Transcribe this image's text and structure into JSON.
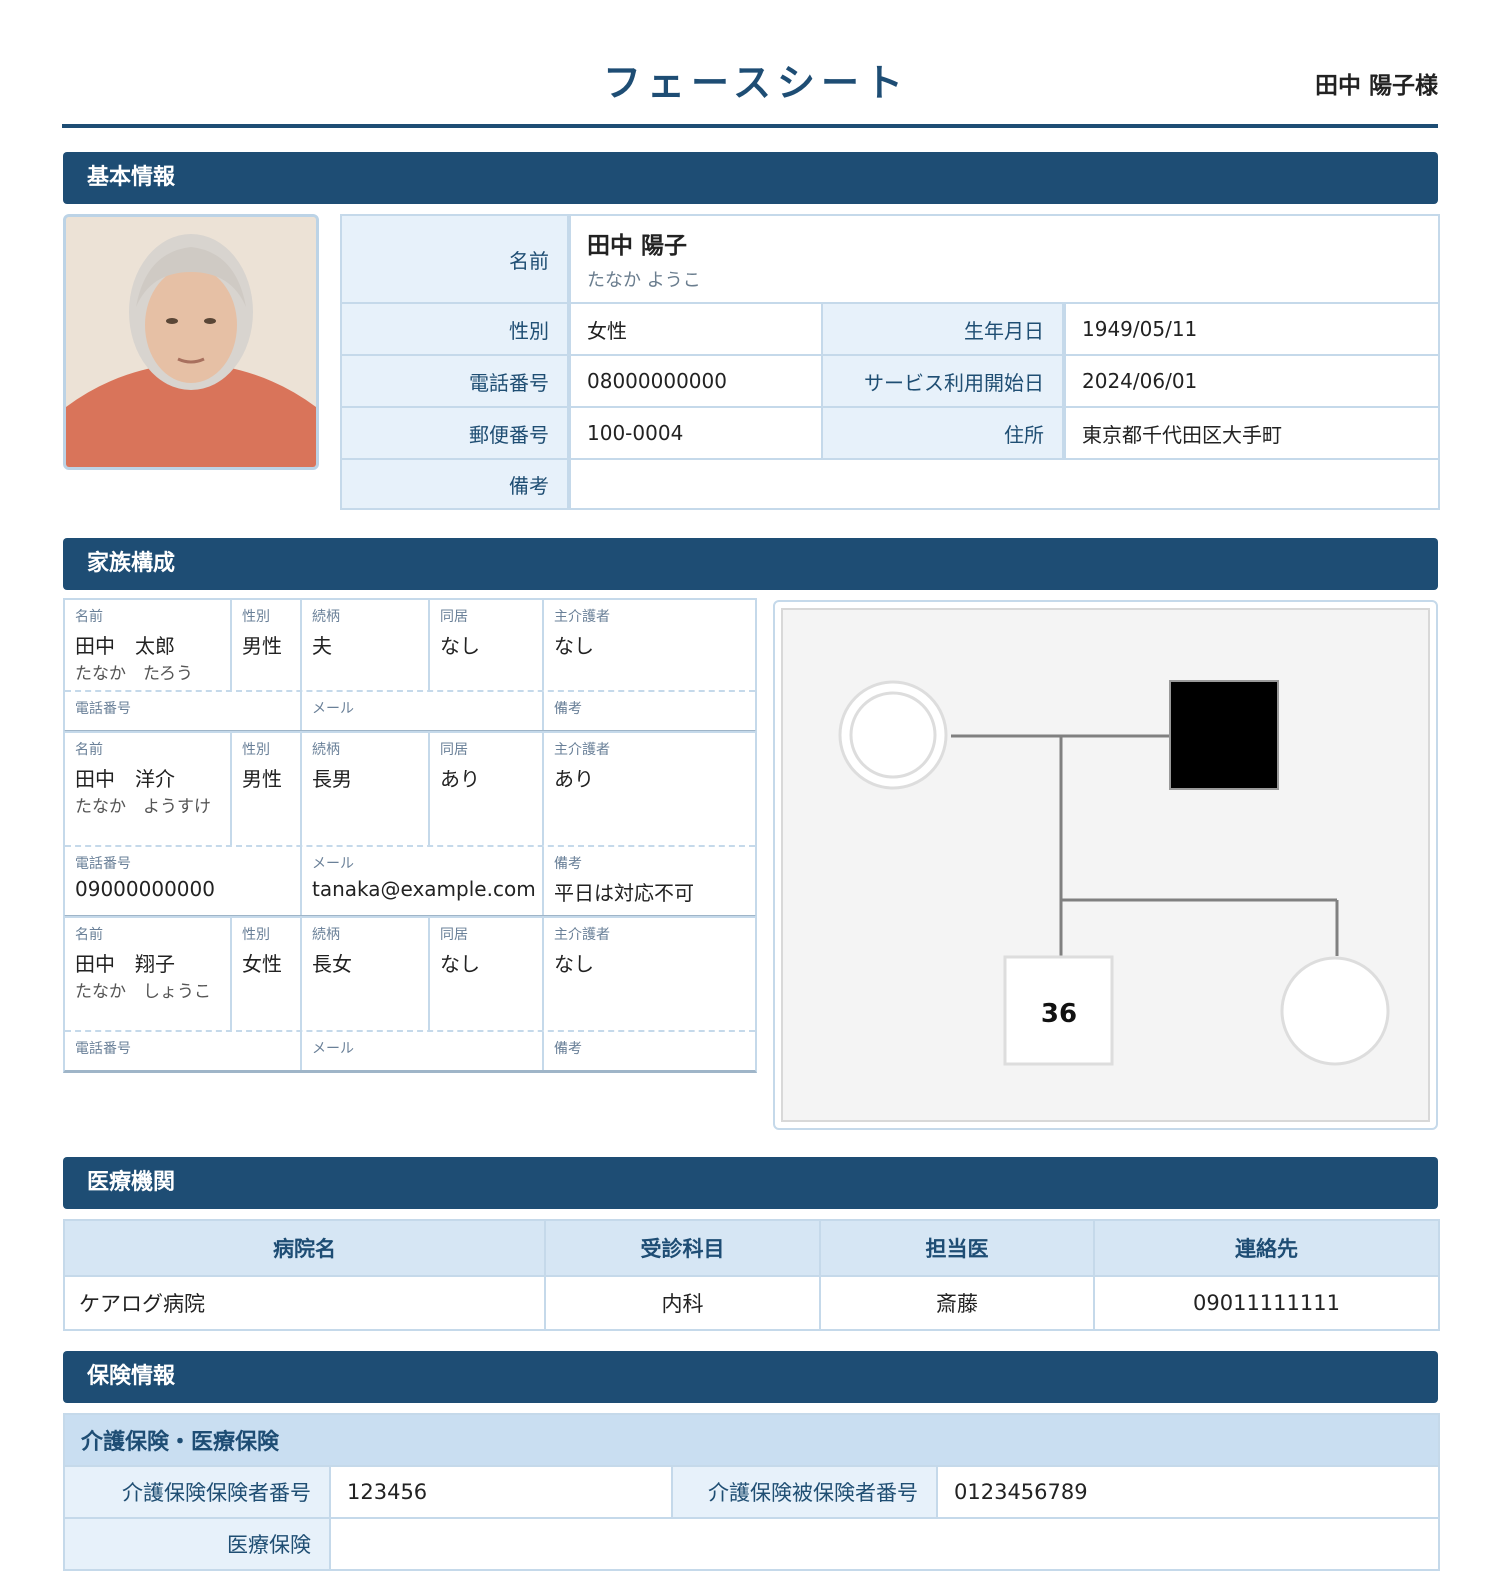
{
  "header": {
    "title": "フェースシート",
    "patient_name": "田中 陽子様"
  },
  "sections": {
    "basic": "基本情報",
    "family": "家族構成",
    "medical": "医療機関",
    "insurance": "保険情報"
  },
  "basic": {
    "labels": {
      "name": "名前",
      "gender": "性別",
      "birthdate": "生年月日",
      "phone": "電話番号",
      "service_start": "サービス利用開始日",
      "postal": "郵便番号",
      "address": "住所",
      "notes": "備考"
    },
    "name": "田中 陽子",
    "name_kana": "たなか ようこ",
    "gender": "女性",
    "birthdate": "1949/05/11",
    "phone": "08000000000",
    "service_start": "2024/06/01",
    "postal": "100-0004",
    "address": "東京都千代田区大手町",
    "notes": ""
  },
  "family": {
    "labels": {
      "name": "名前",
      "gender": "性別",
      "relation": "続柄",
      "cohabit": "同居",
      "caregiver": "主介護者",
      "phone": "電話番号",
      "email": "メール",
      "notes": "備考"
    },
    "members": [
      {
        "name": "田中　太郎",
        "kana": "たなか　たろう",
        "gender": "男性",
        "relation": "夫",
        "cohabit": "なし",
        "caregiver": "なし",
        "phone": "",
        "email": "",
        "notes": ""
      },
      {
        "name": "田中　洋介",
        "kana": "たなか　ようすけ",
        "gender": "男性",
        "relation": "長男",
        "cohabit": "あり",
        "caregiver": "あり",
        "phone": "09000000000",
        "email": "tanaka@example.com",
        "notes": "平日は対応不可"
      },
      {
        "name": "田中　翔子",
        "kana": "たなか　しょうこ",
        "gender": "女性",
        "relation": "長女",
        "cohabit": "なし",
        "caregiver": "なし",
        "phone": "",
        "email": "",
        "notes": ""
      }
    ]
  },
  "genogram": {
    "son_age": "36"
  },
  "medical": {
    "headers": [
      "病院名",
      "受診科目",
      "担当医",
      "連絡先"
    ],
    "rows": [
      [
        "ケアログ病院",
        "内科",
        "斎藤",
        "09011111111"
      ]
    ]
  },
  "insurance": {
    "subheader": "介護保険・医療保険",
    "labels": {
      "care_insurer": "介護保険保険者番号",
      "care_insured": "介護保険被保険者番号",
      "medical": "医療保険"
    },
    "care_insurer_no": "123456",
    "care_insured_no": "0123456789"
  }
}
